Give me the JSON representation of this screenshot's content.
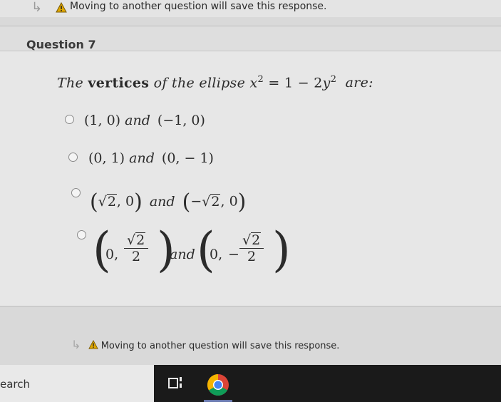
{
  "warning_top": {
    "text": "Moving to another question will save this response."
  },
  "question": {
    "title": "Question 7",
    "prompt": {
      "prefix": "The",
      "bold": "vertices",
      "middle": "of the ellipse",
      "equation_left": "x",
      "equation_mid": " = 1 − 2",
      "equation_var": "y",
      "exp": "2",
      "suffix": "are:"
    },
    "options": [
      {
        "a": "(1, 0)",
        "and": "and",
        "b": "(−1, 0)"
      },
      {
        "a": "(0, 1)",
        "and": "and",
        "b": "(0, − 1)"
      },
      {
        "a_rad": "2",
        "and": "and",
        "b_rad": "2"
      },
      {
        "num_rad": "2",
        "den": "2",
        "and": "and"
      }
    ]
  },
  "warning_bottom": {
    "text": "Moving to another question will save this response."
  },
  "taskbar": {
    "search_text": "earch"
  },
  "colors": {
    "page_bg": "#d9d9d9",
    "card_bg": "#e7e7e7",
    "taskbar": "#1a1a1a",
    "warning_icon": "#e0a800"
  }
}
